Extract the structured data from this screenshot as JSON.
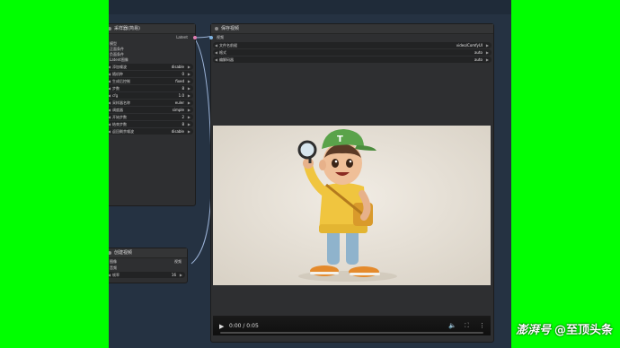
{
  "colors": {
    "background": "#00ff00",
    "canvas": "#253242",
    "node": "#2e2f31",
    "link": "#9bb2d6"
  },
  "node_left": {
    "title": "采样器(简易)",
    "output_label": "Latent",
    "inputs": [
      "模型",
      "正面条件",
      "负面条件",
      "Latent图像"
    ],
    "widgets": [
      {
        "label": "添加噪波",
        "value": "disable"
      },
      {
        "label": "随机种",
        "value": "0"
      },
      {
        "label": "生成后控制",
        "value": "fixed"
      },
      {
        "label": "步数",
        "value": "8"
      },
      {
        "label": "cfg",
        "value": "1.0"
      },
      {
        "label": "采样器名称",
        "value": "euler"
      },
      {
        "label": "调度器",
        "value": "simple"
      },
      {
        "label": "开始步数",
        "value": "2"
      },
      {
        "label": "结束步数",
        "value": "8"
      },
      {
        "label": "返回剩余噪波",
        "value": "disable"
      }
    ]
  },
  "node_bottom": {
    "title": "创建视频",
    "output_label": "视频",
    "inputs": [
      "图像",
      "音频"
    ],
    "widget": {
      "label": "帧率",
      "value": "16"
    }
  },
  "node_right": {
    "title": "保存视频",
    "input_label": "视频",
    "widgets": [
      {
        "label": "文件名前缀",
        "value": "video/ComfyUI"
      },
      {
        "label": "格式",
        "value": "auto"
      },
      {
        "label": "编解码器",
        "value": "auto"
      }
    ]
  },
  "player": {
    "time": "0:00 / 0:05"
  },
  "watermark": {
    "brand": "澎湃号",
    "account": "@至顶头条"
  }
}
